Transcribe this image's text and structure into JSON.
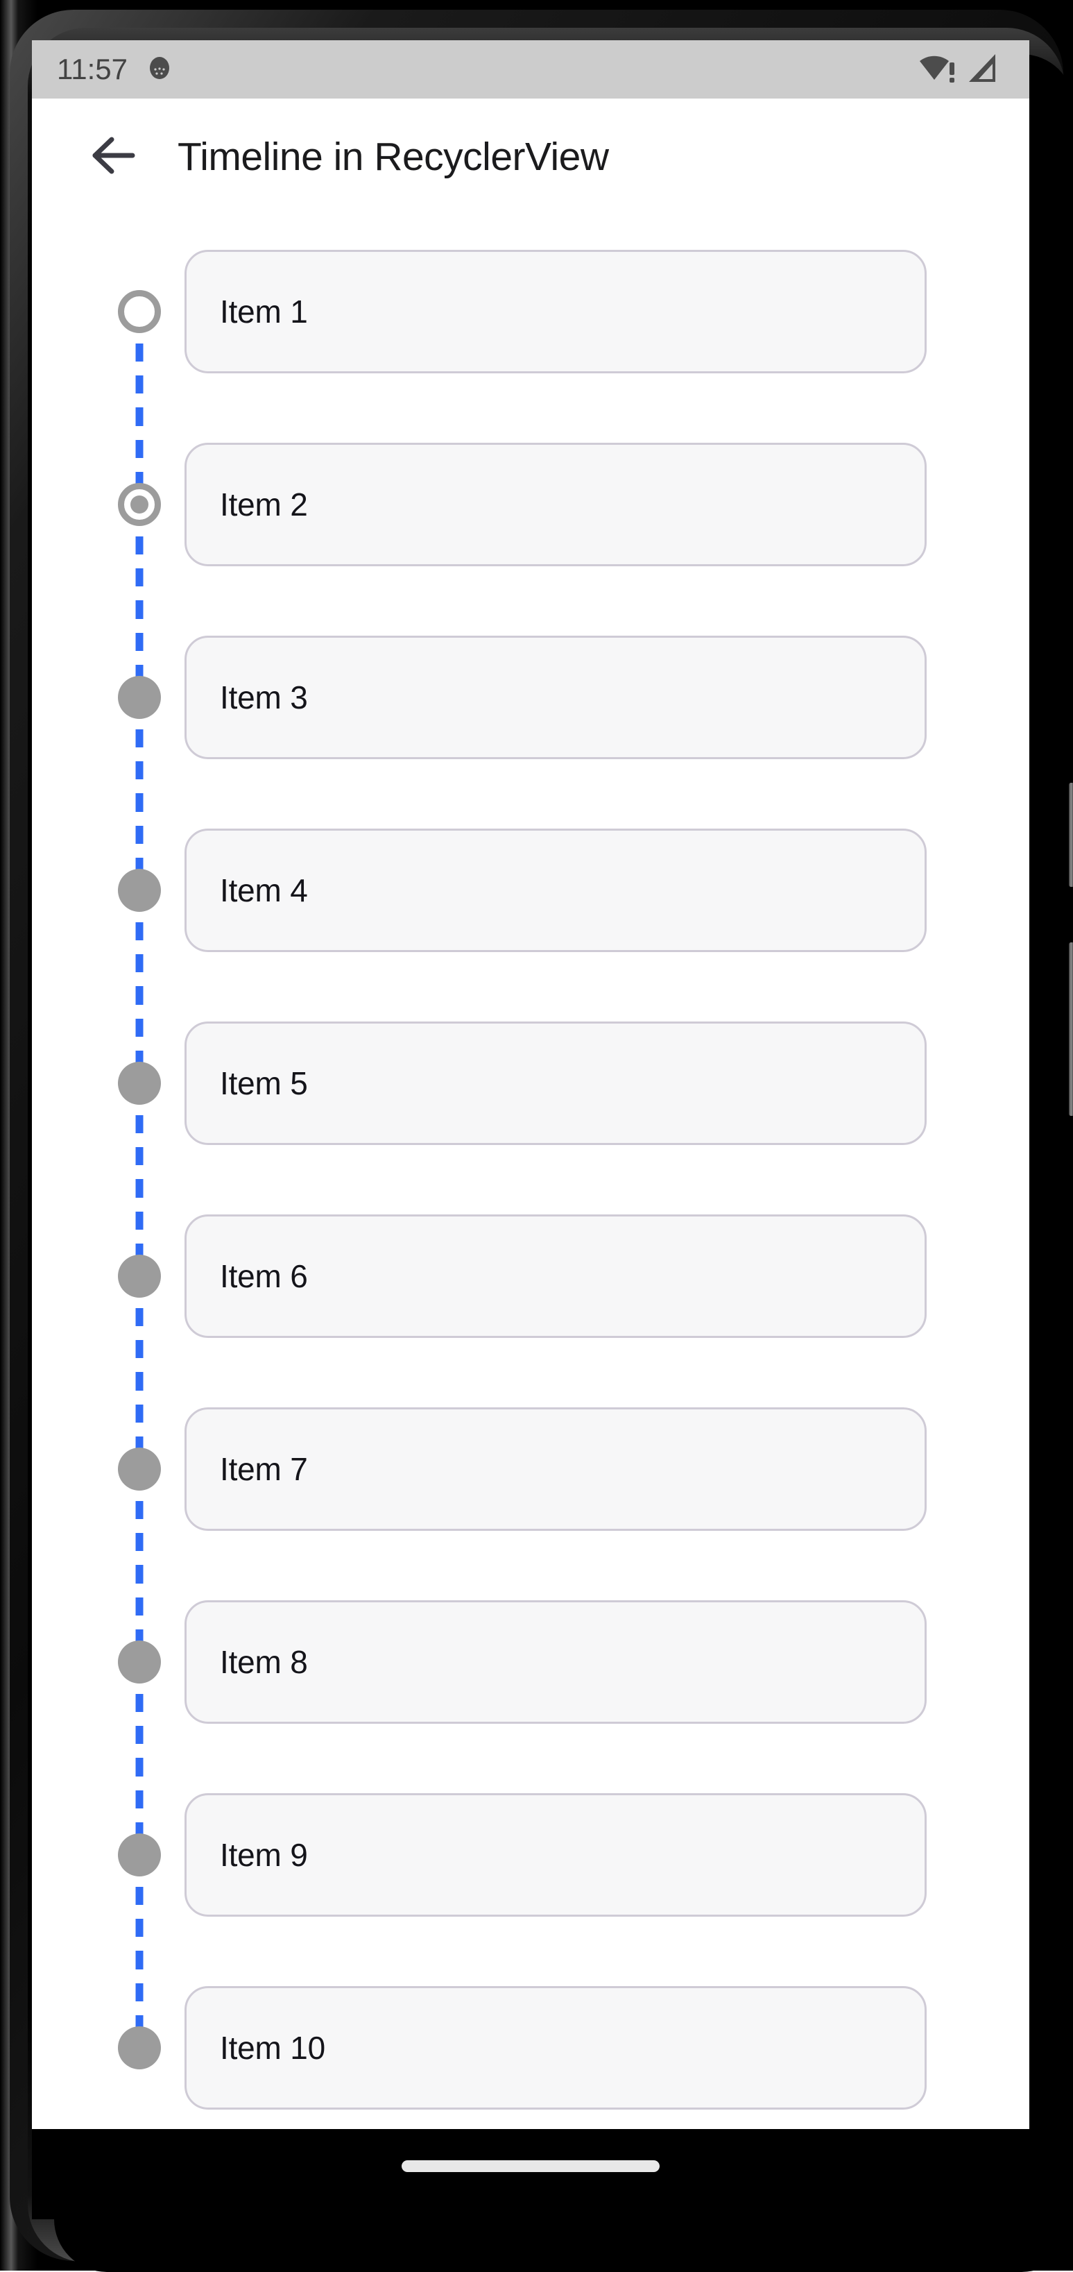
{
  "device": {
    "status_bar": {
      "clock": "11:57",
      "notification_icon": "android-head-icon",
      "wifi_icon": "wifi-no-internet-icon",
      "cellular_icon": "cellular-signal-icon",
      "background_color": "#cccccc",
      "icon_color": "#4c4c4c"
    },
    "nav_bar": {
      "home_indicator": "home-indicator-pill",
      "background_color": "#000000"
    }
  },
  "app_bar": {
    "back_icon": "arrow-left-icon",
    "title": "Timeline in RecyclerView",
    "title_color": "#1b1b1d",
    "background_color": "#ffffff"
  },
  "timeline": {
    "line_color": "#2f6bf5",
    "marker_color": "#9c9c9c",
    "card_background": "#f7f7f8",
    "card_border_color": "#cfcbd6",
    "items": [
      {
        "label": "Item 1",
        "marker": "hollow"
      },
      {
        "label": "Item 2",
        "marker": "ringdot"
      },
      {
        "label": "Item 3",
        "marker": "filled"
      },
      {
        "label": "Item 4",
        "marker": "filled"
      },
      {
        "label": "Item 5",
        "marker": "filled"
      },
      {
        "label": "Item 6",
        "marker": "filled"
      },
      {
        "label": "Item 7",
        "marker": "filled"
      },
      {
        "label": "Item 8",
        "marker": "filled"
      },
      {
        "label": "Item 9",
        "marker": "filled"
      },
      {
        "label": "Item 10",
        "marker": "filled"
      }
    ]
  }
}
